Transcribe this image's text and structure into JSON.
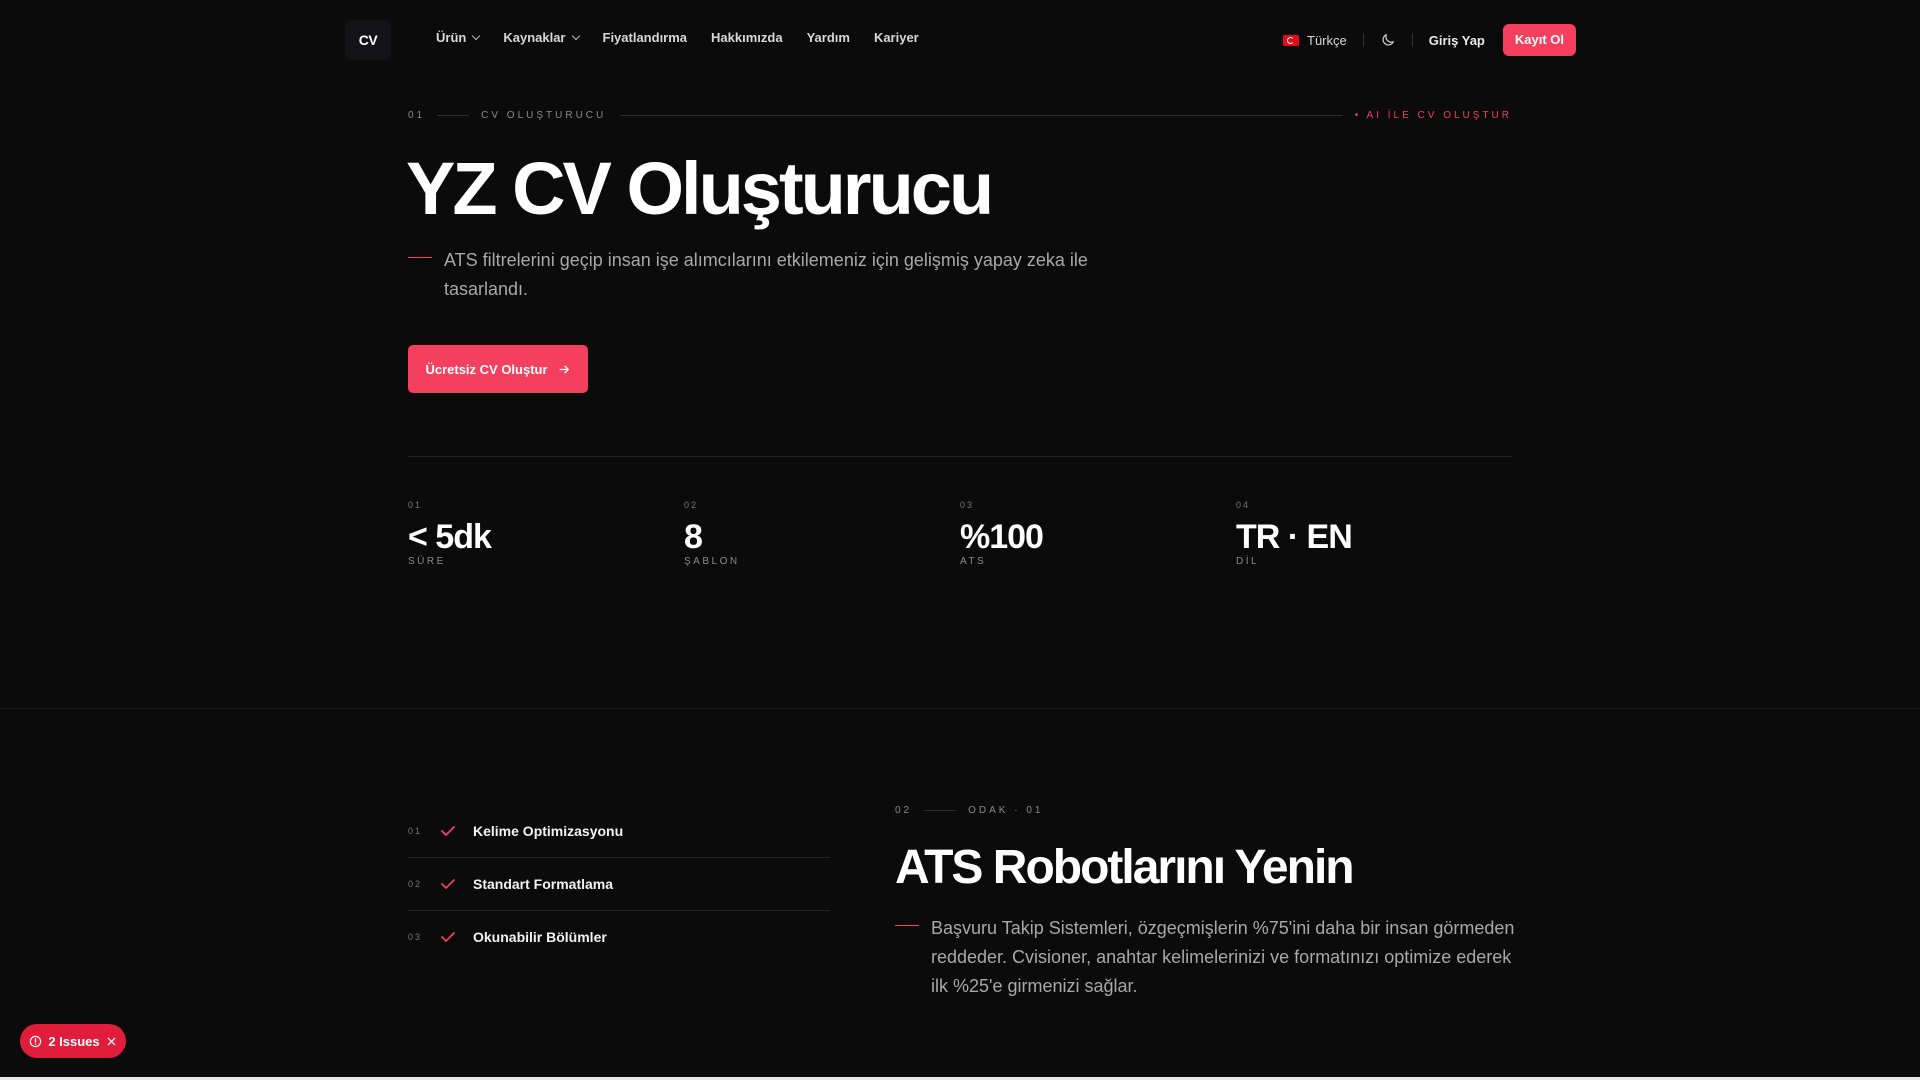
{
  "nav": {
    "logo": "CV",
    "links": [
      {
        "label": "Ürün",
        "dropdown": true
      },
      {
        "label": "Kaynaklar",
        "dropdown": true
      },
      {
        "label": "Fiyatlandırma",
        "dropdown": false
      },
      {
        "label": "Hakkımızda",
        "dropdown": false
      },
      {
        "label": "Yardım",
        "dropdown": false
      },
      {
        "label": "Kariyer",
        "dropdown": false
      }
    ],
    "language": "Türkçe",
    "login": "Giriş Yap",
    "signup": "Kayıt Ol"
  },
  "hero": {
    "eyebrow_num": "01",
    "eyebrow_label": "CV OLUŞTURUCU",
    "eyebrow_accent": "• AI İLE CV OLUŞTUR",
    "title": "YZ CV Oluşturucu",
    "description": "ATS filtrelerini geçip insan işe alımcılarını etkilemeniz için gelişmiş yapay zeka ile tasarlandı.",
    "cta": "Ücretsiz CV Oluştur"
  },
  "stats": [
    {
      "num": "01",
      "value": "< 5dk",
      "label": "SÜRE"
    },
    {
      "num": "02",
      "value": "8",
      "label": "ŞABLON"
    },
    {
      "num": "03",
      "value": "%100",
      "label": "ATS"
    },
    {
      "num": "04",
      "value": "TR · EN",
      "label": "DİL"
    }
  ],
  "features": [
    {
      "num": "01",
      "label": "Kelime Optimizasyonu"
    },
    {
      "num": "02",
      "label": "Standart Formatlama"
    },
    {
      "num": "03",
      "label": "Okunabilir Bölümler"
    }
  ],
  "ats": {
    "eyebrow_num": "02",
    "eyebrow_label": "ODAK · 01",
    "title": "ATS Robotlarını Yenin",
    "description": "Başvuru Takip Sistemleri, özgeçmişlerin %75'ini daha bir insan görmeden reddeder. Cvisioner, anahtar kelimelerinizi ve formatınızı optimize ederek ilk %25'e girmenizi sağlar."
  },
  "issues": {
    "label": "2 Issues"
  },
  "colors": {
    "accent": "#f43f5e",
    "background": "#0b0b0c",
    "issues_badge": "#e01e3c"
  }
}
